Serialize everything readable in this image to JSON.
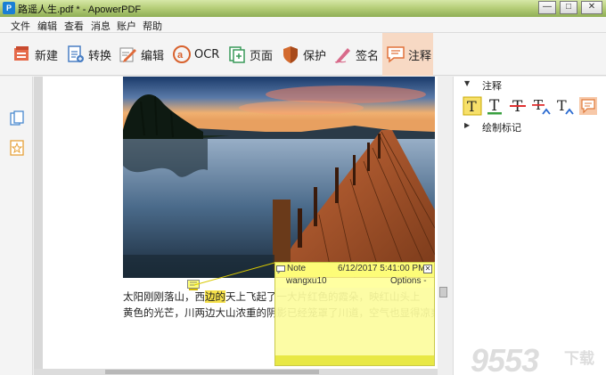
{
  "window": {
    "title": "路遥人生.pdf * - ApowerPDF",
    "min_label": "—",
    "max_label": "□",
    "close_label": "✕"
  },
  "menu": [
    "文件",
    "编辑",
    "查看",
    "消息",
    "账户",
    "帮助"
  ],
  "toolbar": {
    "new": "新建",
    "convert": "转换",
    "edit": "编辑",
    "ocr": "OCR",
    "page": "页面",
    "protect": "保护",
    "sign": "签名",
    "annotate": "注释"
  },
  "document": {
    "line1_pre": "太阳刚刚落山，西",
    "line1_hl": "边的",
    "line1_post": "天上飞起了一大片红色的霞朵，映红山头上",
    "line2": "黄色的光芒，川两边大山浓重的阴影已经笼罩了川道，空气也显得凉爽了"
  },
  "note": {
    "title": "Note",
    "date": "6/12/2017 5:41:00 PM",
    "author": "wangxu10",
    "options": "Options -",
    "close": "✕"
  },
  "right_panel": {
    "section_annotate": "注释",
    "section_draw": "绘制标记",
    "tools": [
      "highlight-text-icon",
      "underline-text-icon",
      "strikethrough-text-icon",
      "replace-text-icon",
      "insert-text-icon",
      "sticky-note-icon"
    ]
  },
  "watermark": {
    "main": "9553",
    "sub": "下载"
  },
  "colors": {
    "accent_orange": "#e55a2b",
    "highlight_yellow": "#f5e04a",
    "note_yellow": "#ffff8c",
    "active_tool_bg": "#f7d9c4"
  }
}
